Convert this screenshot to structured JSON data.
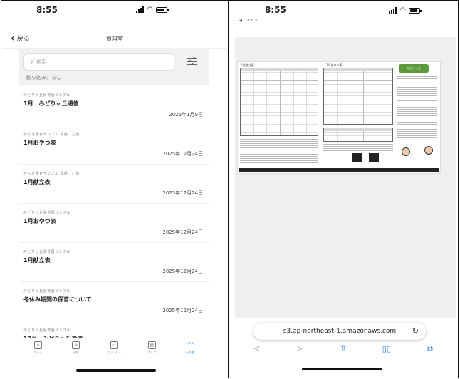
{
  "left": {
    "status": {
      "time": "8:55"
    },
    "navbar": {
      "back_label": "戻る",
      "title": "資料室"
    },
    "search": {
      "placeholder": "検索",
      "filter_text": "絞り込み：なし"
    },
    "items": [
      {
        "sub": "みどりヶ丘保育園サンプル",
        "title": "1月　みどりヶ丘通信",
        "date": "2026年1月9日"
      },
      {
        "sub": "かんき保育サンプル 北館　乙館",
        "title": "1月おやつ表",
        "date": "2025年12月24日"
      },
      {
        "sub": "かんき保育サンプル 北館　乙館",
        "title": "1月献立表",
        "date": "2025年12月24日"
      },
      {
        "sub": "みどりヶ丘保育園サンプル",
        "title": "1月おやつ表",
        "date": "2025年12月24日"
      },
      {
        "sub": "みどりヶ丘保育園サンプル",
        "title": "1月献立表",
        "date": "2025年12月24日"
      },
      {
        "sub": "みどりヶ丘保育園サンプル",
        "title": "冬休み期間の保育について",
        "date": "2025年12月24日"
      },
      {
        "sub": "みどりヶ丘保育園サンプル",
        "title": "12月　みどりヶ丘通信",
        "date": ""
      }
    ],
    "tabs": [
      {
        "label": "ホーム",
        "icon": "home-icon",
        "glyph": "⌂"
      },
      {
        "label": "連絡",
        "icon": "message-icon",
        "glyph": "≡"
      },
      {
        "label": "カレンダー",
        "icon": "calendar-icon",
        "glyph": "▭"
      },
      {
        "label": "ストア",
        "icon": "store-icon",
        "glyph": "▤"
      },
      {
        "label": "その他",
        "icon": "more-icon",
        "glyph": "···"
      }
    ],
    "active_tab_color": "#2e8ad8"
  },
  "right": {
    "status": {
      "time": "8:55",
      "back_app": "◀ コドモン"
    },
    "document": {
      "title_left": "1月献立表",
      "title_right": "1月おやつ表",
      "badge": "みどりヶ丘"
    },
    "url": "s3.ap-northeast-1.amazonaws.com",
    "toolbar": {
      "back": "<",
      "forward": ">",
      "share": "⇧",
      "bookmarks": "📖",
      "tabs": "⧉"
    },
    "accent_color": "#2e7ee0"
  }
}
